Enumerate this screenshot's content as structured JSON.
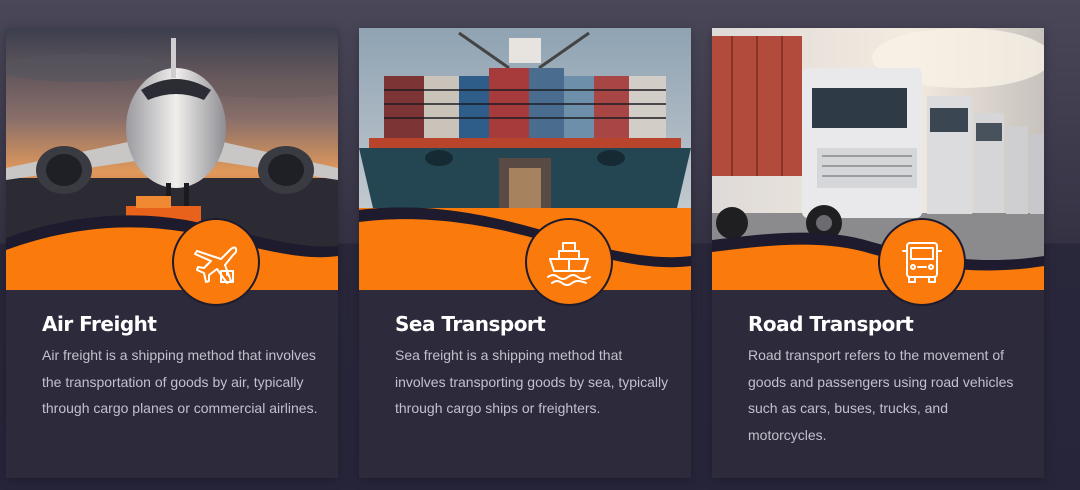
{
  "cards": [
    {
      "title": "Air Freight",
      "description": "Air freight is a shipping method that involves the transportation of goods by air, typically through cargo planes or commercial airlines.",
      "image": "airplane-at-sunset",
      "icon": "airplane-icon"
    },
    {
      "title": "Sea Transport",
      "description": "Sea freight is a shipping method that involves transporting goods by sea, typically through cargo ships or freighters.",
      "image": "container-ship",
      "icon": "ship-icon"
    },
    {
      "title": "Road Transport",
      "description": "Road transport refers to the movement of goods and passengers using road vehicles such as cars, buses, trucks, and motorcycles.",
      "image": "row-of-trucks",
      "icon": "truck-icon"
    }
  ],
  "colors": {
    "accent": "#fb7a0c",
    "card_background": "#2c2a3b",
    "title_text": "#ffffff",
    "body_text": "#c3c1cd"
  }
}
